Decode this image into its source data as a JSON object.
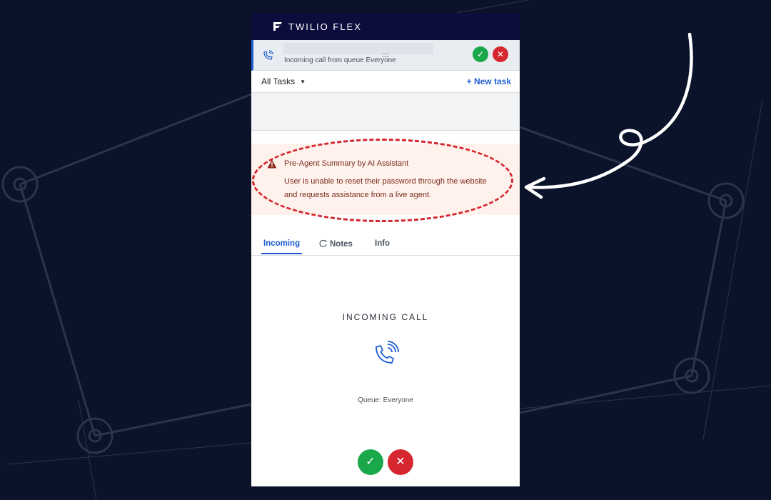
{
  "app": {
    "title": "TWILIO FLEX"
  },
  "task": {
    "label": "Incoming call from queue Everyone",
    "accept_icon": "check-icon",
    "reject_icon": "close-icon"
  },
  "task_list": {
    "filter_label": "All Tasks",
    "new_task_label": "+ New task"
  },
  "summary": {
    "title": "Pre-Agent Summary by AI Assistant",
    "body": "User is unable to reset their password through the website and requests assistance from a live agent.",
    "icon": "warning-icon"
  },
  "tabs": [
    {
      "label": "Incoming",
      "active": true
    },
    {
      "label": "Notes",
      "active": false
    },
    {
      "label": "Info",
      "active": false
    }
  ],
  "call": {
    "title": "INCOMING CALL",
    "queue": "Queue: Everyone"
  },
  "colors": {
    "accent": "#1f5fd0",
    "accept": "#1aa84a",
    "reject": "#d6262f",
    "header": "#0d0d3d",
    "background": "#0b132a",
    "summary_bg": "#fff2ec"
  }
}
